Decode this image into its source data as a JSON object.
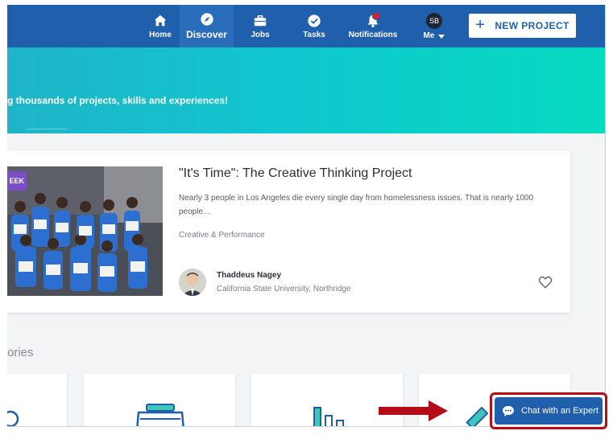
{
  "nav": {
    "items": [
      {
        "label": "Home",
        "icon": "home-icon"
      },
      {
        "label": "Discover",
        "icon": "compass-icon"
      },
      {
        "label": "Jobs",
        "icon": "briefcase-icon"
      },
      {
        "label": "Tasks",
        "icon": "check-circle-icon"
      },
      {
        "label": "Notifications",
        "icon": "bell-icon"
      },
      {
        "label": "Me",
        "icon": "avatar"
      }
    ],
    "avatar_initials": "SB",
    "new_project_plus": "+",
    "new_project_label": "NEW PROJECT"
  },
  "hero": {
    "text": "g thousands of projects, skills and experiences!"
  },
  "project": {
    "badge": "EEK",
    "title": "\"It's Time\": The Creative Thinking Project",
    "description": "Nearly 3 people in Los Angeles die every single day from homelessness issues. That is nearly 1000 people...",
    "category": "Creative & Performance",
    "author_name": "Thaddeus Nagey",
    "author_school": "California State University, Northridge"
  },
  "categories": {
    "label": "ories"
  },
  "chat": {
    "label": "Chat with an Expert"
  },
  "colors": {
    "nav_bg": "#1f5fab",
    "annotation_red": "#b40d17",
    "badge_purple": "#7b4fc6",
    "notification_dot": "#e21b2b"
  }
}
